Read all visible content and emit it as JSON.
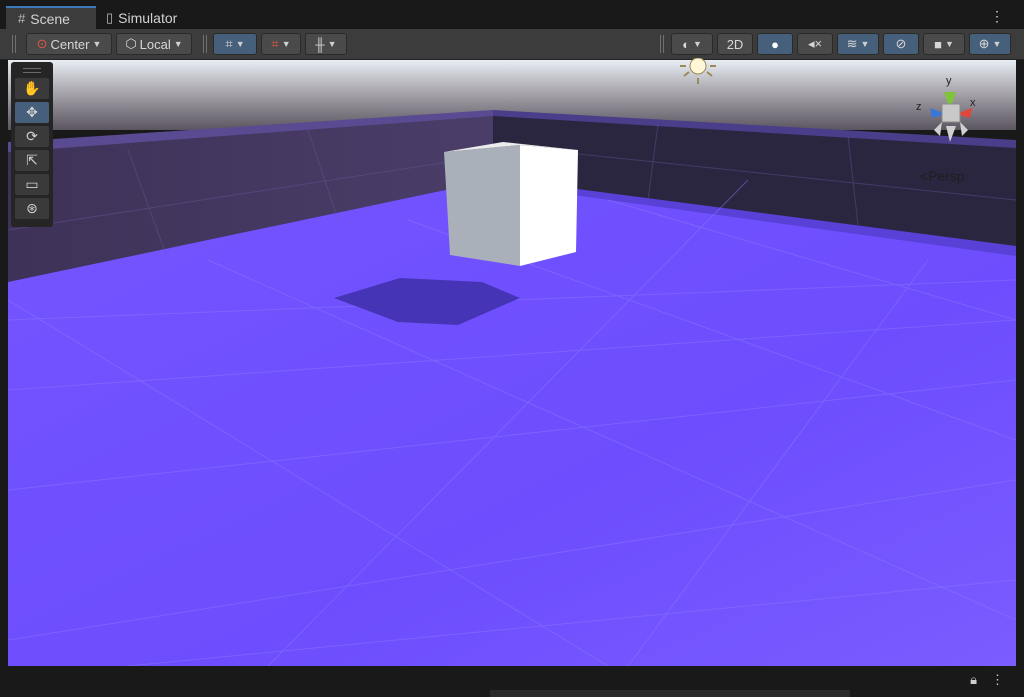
{
  "tabs": [
    {
      "label": "Scene",
      "icon": "grid-hash-icon",
      "active": true
    },
    {
      "label": "Simulator",
      "icon": "device-icon",
      "active": false
    }
  ],
  "toolbar": {
    "pivot_label": "Center",
    "space_label": "Local",
    "mode_2d_label": "2D"
  },
  "gizmo": {
    "y_label": "y",
    "x_label": "x",
    "z_label": "z",
    "projection_label": "Persp",
    "colors": {
      "x": "#e0463a",
      "y": "#7ec33a",
      "z": "#3a76d6"
    }
  },
  "scene": {
    "ground_color": "#6e4cff",
    "skybox_top": "#e6ecf2",
    "horizon_color": "#5b5560"
  },
  "tools": [
    "hand-tool",
    "move-tool",
    "rotate-tool",
    "scale-tool",
    "rect-tool",
    "transform-tool"
  ]
}
